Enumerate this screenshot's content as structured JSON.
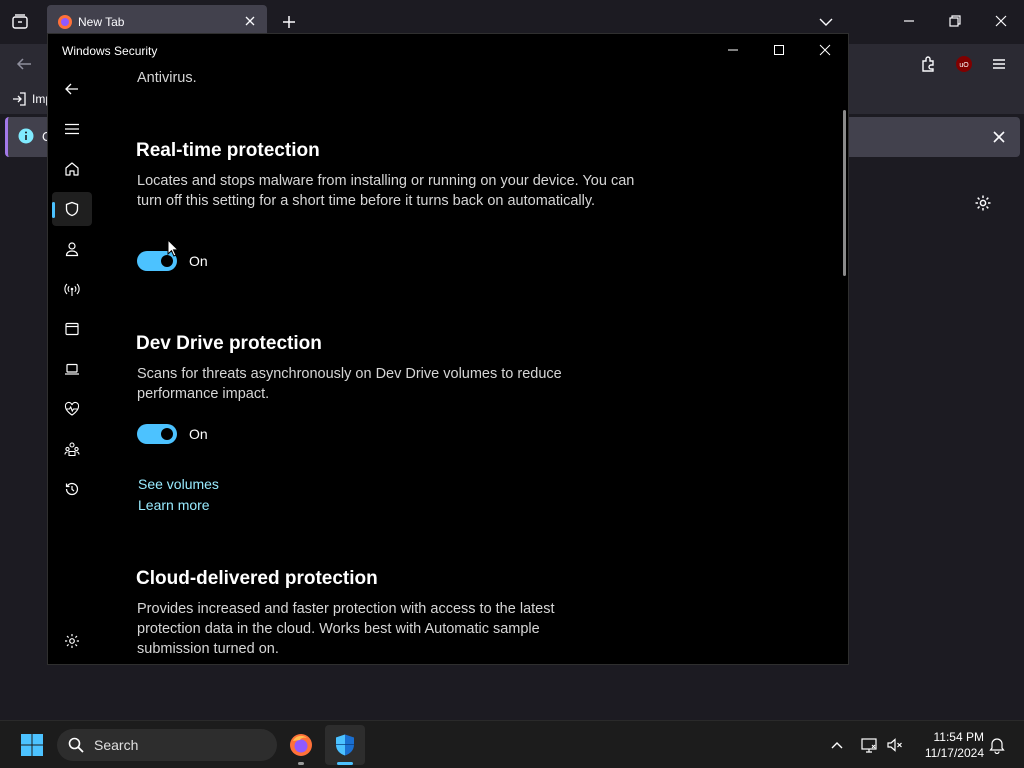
{
  "browser": {
    "tab_title": "New Tab",
    "bookmark_partial": "Imp",
    "notice_partial": "O"
  },
  "window": {
    "title": "Windows Security"
  },
  "content": {
    "intro_fragment": "Antivirus.",
    "sections": [
      {
        "heading": "Real-time protection",
        "description": "Locates and stops malware from installing or running on your device. You can turn off this setting for a short time before it turns back on automatically.",
        "toggle_state": "On"
      },
      {
        "heading": "Dev Drive protection",
        "description": "Scans for threats asynchronously on Dev Drive volumes to reduce performance impact.",
        "toggle_state": "On",
        "links": [
          "See volumes",
          "Learn more"
        ]
      },
      {
        "heading": "Cloud-delivered protection",
        "description": "Provides increased and faster protection with access to the latest protection data in the cloud. Works best with Automatic sample submission turned on."
      }
    ]
  },
  "nav": {
    "items": [
      "back-icon",
      "menu-icon",
      "home-icon",
      "shield-icon",
      "account-icon",
      "network-icon",
      "app-browser-icon",
      "device-security-icon",
      "health-icon",
      "family-icon",
      "history-icon",
      "settings-icon"
    ],
    "active": "shield-icon"
  },
  "taskbar": {
    "search_placeholder": "Search",
    "time": "11:54 PM",
    "date": "11/17/2024"
  },
  "colors": {
    "accent": "#4cc2ff",
    "link": "#99ebff"
  }
}
